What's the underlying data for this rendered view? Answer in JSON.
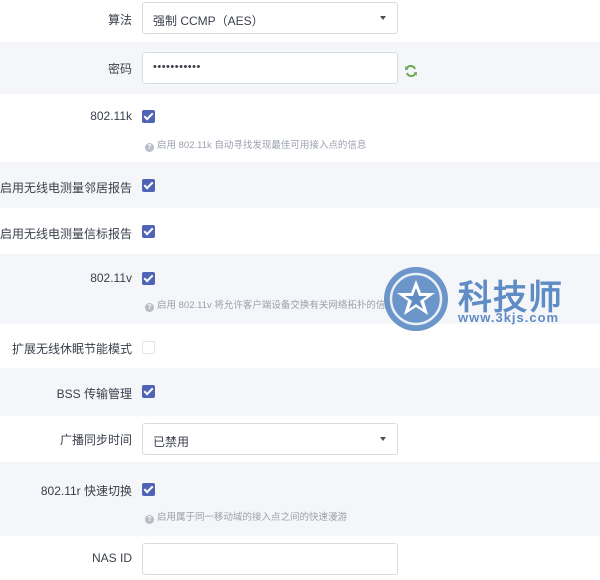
{
  "fields": {
    "algorithm": {
      "label": "算法",
      "value": "强制 CCMP（AES）"
    },
    "password": {
      "label": "密码",
      "value": "•••••••••••"
    },
    "dot11k": {
      "label": "802.11k",
      "checked": true,
      "help": "启用 802.11k 自动寻找发现最佳可用接入点的信息"
    },
    "neighbor_report": {
      "label": "启用无线电测量邻居报告",
      "checked": true
    },
    "beacon_report": {
      "label": "启用无线电测量信标报告",
      "checked": true
    },
    "dot11v": {
      "label": "802.11v",
      "checked": true,
      "help": "启用 802.11v 将允许客户端设备交换有关网络拓扑的信息"
    },
    "wnm_sleep": {
      "label": "扩展无线休眠节能模式",
      "checked": false
    },
    "bss_transition": {
      "label": "BSS 传输管理",
      "checked": true
    },
    "time_advertisement": {
      "label": "广播同步时间",
      "value": "已禁用"
    },
    "dot11r": {
      "label": "802.11r 快速切换",
      "checked": true,
      "help": "启用属于同一移动域的接入点之间的快速漫游"
    },
    "nas_id": {
      "label": "NAS ID",
      "value": ""
    }
  },
  "icons": {
    "refresh": "refresh-icon",
    "help": "question-icon",
    "dropdown": "chevron-down-icon"
  },
  "watermark": {
    "title": "科技师",
    "url": "www.3kjs.com"
  },
  "colors": {
    "accent": "#4f63b7",
    "refresh": "#6aa84f",
    "watermark": "#5f8cc4"
  }
}
